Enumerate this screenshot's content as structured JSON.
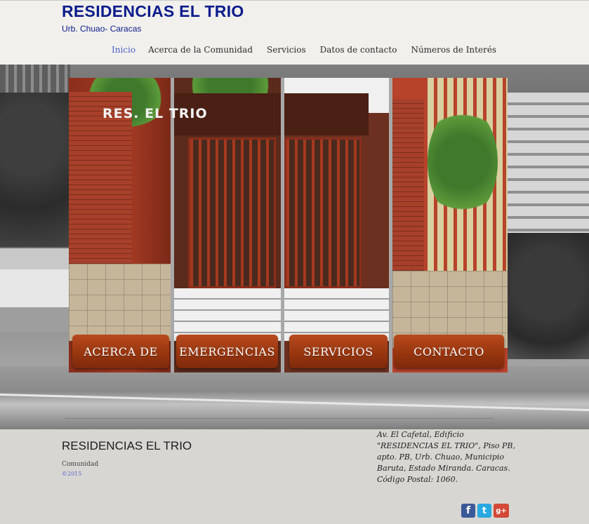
{
  "header": {
    "title": "RESIDENCIAS EL TRIO",
    "subtitle": "Urb. Chuao- Caracas"
  },
  "nav": {
    "items": [
      {
        "label": "Inicio",
        "active": true
      },
      {
        "label": "Acerca de la Comunidad",
        "active": false
      },
      {
        "label": "Servicios",
        "active": false
      },
      {
        "label": "Datos de contacto",
        "active": false
      },
      {
        "label": "Números de Interés",
        "active": false
      }
    ]
  },
  "hero": {
    "sign_text": "RES. EL TRIO",
    "buttons": [
      {
        "label": "ACERCA DE"
      },
      {
        "label": "EMERGENCIAS"
      },
      {
        "label": "SERVICIOS"
      },
      {
        "label": "CONTACTO"
      }
    ]
  },
  "footer": {
    "title": "RESIDENCIAS EL TRIO",
    "community": "Comunidad",
    "copyright": "©2015",
    "address_lines": [
      "Av.  El Cafetal, Edificio",
      "\"RESIDENCIAS EL TRIO\",  Piso PB,",
      "apto. PB, Urb. Chuao, Municipio",
      "Baruta, Estado Miranda. Caracas.",
      "Código Postal: 1060."
    ],
    "social": [
      {
        "icon": "facebook-icon",
        "glyph": "f"
      },
      {
        "icon": "twitter-icon",
        "glyph": "t"
      },
      {
        "icon": "google-plus-icon",
        "glyph": "g+"
      }
    ]
  },
  "colors": {
    "brand_blue": "#0c1c8c",
    "nav_active": "#4a5fc8",
    "button_brown": "#98360f",
    "facebook": "#3b5998",
    "twitter": "#29a9e0",
    "google_plus": "#d34836"
  }
}
